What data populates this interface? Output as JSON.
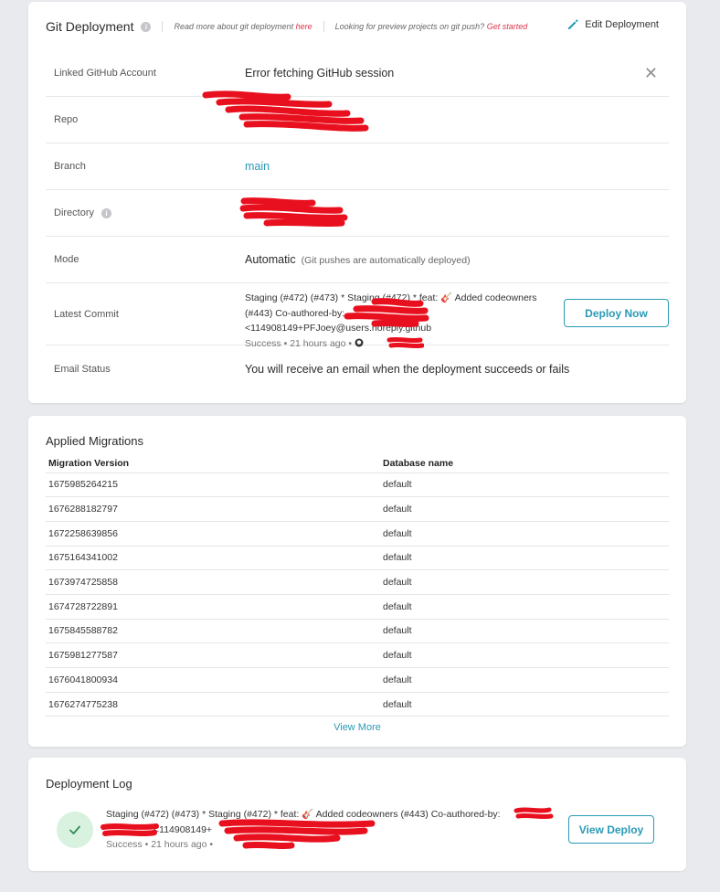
{
  "git_deployment": {
    "title": "Git Deployment",
    "info_icon": "info-icon",
    "read_more_prefix": "Read more about git deployment ",
    "read_more_link": "here",
    "preview_prefix": "Looking for preview projects on git push? ",
    "preview_link": "Get started",
    "edit_label": "Edit Deployment",
    "rows": {
      "github_label": "Linked GitHub Account",
      "github_value": "Error fetching GitHub session",
      "repo_label": "Repo",
      "branch_label": "Branch",
      "branch_value": "main",
      "directory_label": "Directory",
      "mode_label": "Mode",
      "mode_value": "Automatic",
      "mode_note": "(Git pushes are automatically deployed)",
      "commit_label": "Latest Commit",
      "commit_line1": "Staging (#472) (#473) * Staging (#472) * feat: 🎸 Added codeowners",
      "commit_line2": "(#443) Co-authored-by:",
      "commit_line3": "<114908149+PFJoey@users.noreply.github",
      "commit_meta": "Success • 21 hours ago •",
      "deploy_now_label": "Deploy Now",
      "email_label": "Email Status",
      "email_value": "You will receive an email when the deployment succeeds or fails"
    }
  },
  "migrations": {
    "title": "Applied Migrations",
    "columns": [
      "Migration Version",
      "Database name"
    ],
    "rows": [
      [
        "1675985264215",
        "default"
      ],
      [
        "1676288182797",
        "default"
      ],
      [
        "1672258639856",
        "default"
      ],
      [
        "1675164341002",
        "default"
      ],
      [
        "1673974725858",
        "default"
      ],
      [
        "1674728722891",
        "default"
      ],
      [
        "1675845588782",
        "default"
      ],
      [
        "1675981277587",
        "default"
      ],
      [
        "1676041800934",
        "default"
      ],
      [
        "1676274775238",
        "default"
      ]
    ],
    "view_more_label": "View More"
  },
  "deployment_log": {
    "title": "Deployment Log",
    "entry_line1": "Staging (#472) (#473) * Staging (#472) * feat: 🎸 Added codeowners (#443) Co-authored-by:",
    "entry_line2": "<114908149+",
    "entry_meta": "Success • 21 hours ago •",
    "view_deploy_label": "View Deploy",
    "status": "success"
  },
  "colors": {
    "accent": "#2a9ab6",
    "link_red": "#e0344c",
    "success_bg": "#d8f2df",
    "success_check": "#2e8b57",
    "redaction": "#e8101e"
  }
}
